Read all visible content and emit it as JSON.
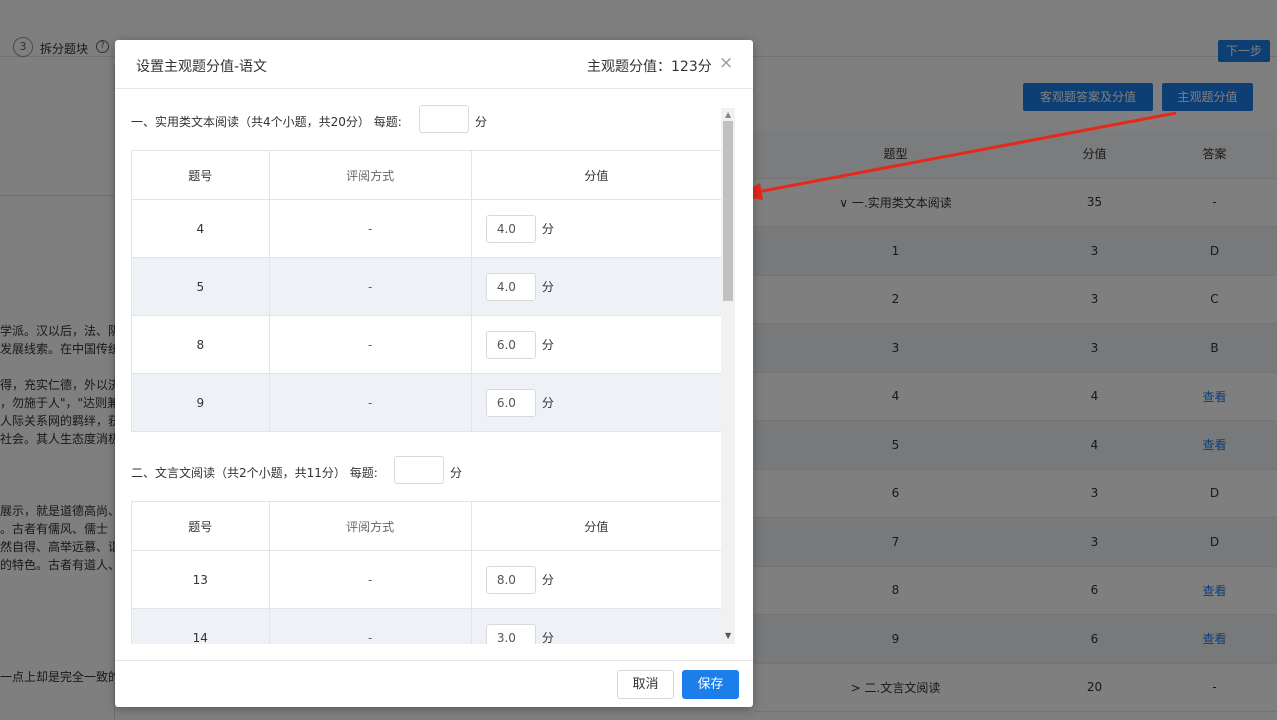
{
  "background": {
    "step_number": "3",
    "step_label": "拆分题块",
    "next_button": "下一步",
    "objective_button": "客观题答案及分值",
    "subjective_button": "主观题分值",
    "table_headers": {
      "type": "题型",
      "score": "分值",
      "answer": "答案"
    },
    "rows": [
      {
        "type": "∨ 一.实用类文本阅读",
        "score": "35",
        "answer": "-",
        "link": false
      },
      {
        "type": "1",
        "score": "3",
        "answer": "D",
        "link": false
      },
      {
        "type": "2",
        "score": "3",
        "answer": "C",
        "link": false
      },
      {
        "type": "3",
        "score": "3",
        "answer": "B",
        "link": false
      },
      {
        "type": "4",
        "score": "4",
        "answer": "查看",
        "link": true
      },
      {
        "type": "5",
        "score": "4",
        "answer": "查看",
        "link": true
      },
      {
        "type": "6",
        "score": "3",
        "answer": "D",
        "link": false
      },
      {
        "type": "7",
        "score": "3",
        "answer": "D",
        "link": false
      },
      {
        "type": "8",
        "score": "6",
        "answer": "查看",
        "link": true
      },
      {
        "type": "9",
        "score": "6",
        "answer": "查看",
        "link": true
      },
      {
        "type": "> 二.文言文阅读",
        "score": "20",
        "answer": "-",
        "link": false
      }
    ],
    "left_text": [
      "学派。汉以后，法、阴",
      "发展线索。在中国传统",
      "得，充实仁德，外以济",
      "，勿施于人\"，\"达则兼",
      "人际关系网的羁绊，获",
      "社会。其人生态度消极",
      "展示，就是道德高尚、",
      "。古者有儒风、儒士",
      "然自得、高举远慕、诣",
      "的特色。古者有道人、",
      "一点上却是完全一致的"
    ]
  },
  "modal": {
    "title": "设置主观题分值-语文",
    "total_label": "主观题分值：123分",
    "close_icon": "×",
    "col_headers": {
      "number": "题号",
      "method": "评阅方式",
      "score": "分值"
    },
    "unit": "分",
    "per_item_label": "每题:",
    "sections": [
      {
        "title": "一、实用类文本阅读（共4个小题，共20分）",
        "per_item_value": "",
        "items": [
          {
            "number": "4",
            "method": "-",
            "score": "4.0"
          },
          {
            "number": "5",
            "method": "-",
            "score": "4.0"
          },
          {
            "number": "8",
            "method": "-",
            "score": "6.0"
          },
          {
            "number": "9",
            "method": "-",
            "score": "6.0"
          }
        ]
      },
      {
        "title": "二、文言文阅读（共2个小题，共11分）",
        "per_item_value": "",
        "items": [
          {
            "number": "13",
            "method": "-",
            "score": "8.0"
          },
          {
            "number": "14",
            "method": "-",
            "score": "3.0"
          }
        ]
      }
    ],
    "cancel_button": "取消",
    "save_button": "保存"
  },
  "colors": {
    "primary": "#1c7ee8",
    "arrow": "#e8271b",
    "row_alt": "#eef2f7"
  }
}
